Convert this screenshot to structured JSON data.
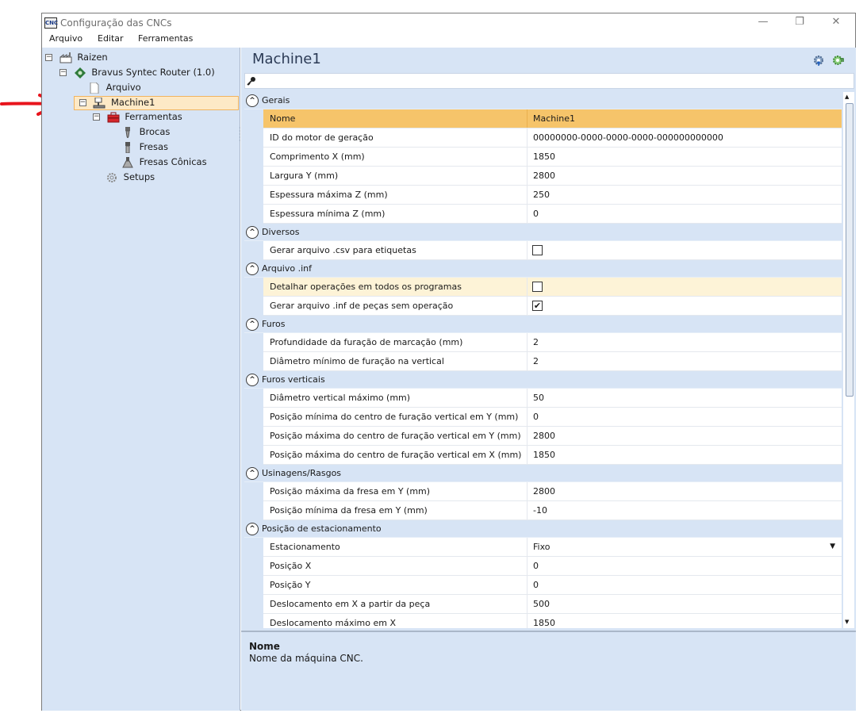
{
  "window": {
    "app_icon_text": "CNC",
    "title": "Configuração das CNCs",
    "controls": {
      "minimize": "—",
      "maximize": "❐",
      "close": "✕"
    }
  },
  "menu": [
    "Arquivo",
    "Editar",
    "Ferramentas"
  ],
  "tree": {
    "root": "Raizen",
    "router": "Bravus Syntec Router (1.0)",
    "file": "Arquivo",
    "machine": "Machine1",
    "tools": "Ferramentas",
    "drills": "Brocas",
    "mills": "Fresas",
    "conical_mills": "Fresas Cônicas",
    "setups": "Setups",
    "expander_symbol": "−"
  },
  "header": {
    "title": "Machine1"
  },
  "search": {
    "icon": "key-icon"
  },
  "categories": [
    {
      "label": "Gerais",
      "rows": [
        {
          "name": "Nome",
          "value": "Machine1"
        },
        {
          "name": "ID do motor de geração",
          "value": "00000000-0000-0000-0000-000000000000"
        },
        {
          "name": "Comprimento X (mm)",
          "value": "1850"
        },
        {
          "name": "Largura Y (mm)",
          "value": "2800"
        },
        {
          "name": "Espessura máxima Z (mm)",
          "value": "250"
        },
        {
          "name": "Espessura mínima Z (mm)",
          "value": "0"
        }
      ]
    },
    {
      "label": "Diversos",
      "rows": [
        {
          "name": "Gerar arquivo .csv para etiquetas",
          "checked": false
        }
      ]
    },
    {
      "label": "Arquivo .inf",
      "rows": [
        {
          "name": "Detalhar operações em todos os programas",
          "checked": false
        },
        {
          "name": "Gerar arquivo .inf de peças sem operação",
          "checked": true
        }
      ]
    },
    {
      "label": "Furos",
      "rows": [
        {
          "name": "Profundidade da furação de marcação (mm)",
          "value": "2"
        },
        {
          "name": "Diâmetro mínimo de furação na vertical",
          "value": "2"
        }
      ]
    },
    {
      "label": "Furos verticais",
      "rows": [
        {
          "name": "Diâmetro vertical máximo (mm)",
          "value": "50"
        },
        {
          "name": "Posição mínima do centro de furação vertical em Y (mm)",
          "value": "0"
        },
        {
          "name": "Posição máxima do centro de furação vertical em Y (mm)",
          "value": "2800"
        },
        {
          "name": "Posição máxima do centro de furação vertical em X (mm)",
          "value": "1850"
        }
      ]
    },
    {
      "label": "Usinagens/Rasgos",
      "rows": [
        {
          "name": "Posição máxima da fresa em Y (mm)",
          "value": "2800"
        },
        {
          "name": "Posição mínima da fresa em Y (mm)",
          "value": "-10"
        }
      ]
    },
    {
      "label": "Posição de estacionamento",
      "rows": [
        {
          "name": "Estacionamento",
          "value": "Fixo",
          "dropdown": true
        },
        {
          "name": "Posição X",
          "value": "0"
        },
        {
          "name": "Posição Y",
          "value": "0"
        },
        {
          "name": "Deslocamento em X a partir da peça",
          "value": "500"
        },
        {
          "name": "Deslocamento máximo em X",
          "value": "1850"
        }
      ]
    }
  ],
  "grid_symbols": {
    "collapse": "^",
    "check": "✔",
    "dropdown": "▼",
    "scroll_up": "▲",
    "scroll_down": "▼"
  },
  "description": {
    "title": "Nome",
    "text": "Nome da máquina CNC."
  },
  "colors": {
    "pane_bg": "#d7e4f5",
    "selected_row": "#f6c46a",
    "highlight_row": "#fdf3d7",
    "arrow": "#e8141c"
  }
}
